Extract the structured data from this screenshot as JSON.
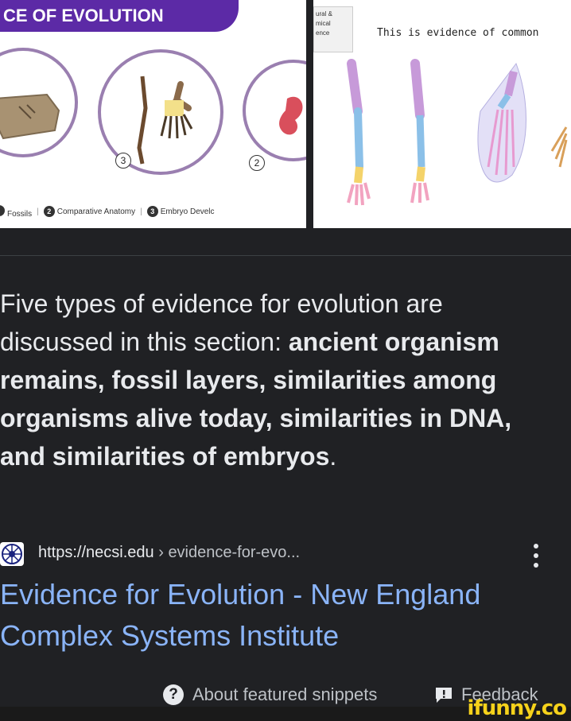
{
  "images": {
    "left": {
      "banner": "CE OF EVOLUTION",
      "circle_numbers": [
        "3",
        "2"
      ],
      "legend": [
        {
          "num": "",
          "label": "Fossils"
        },
        {
          "num": "2",
          "label": "Comparative Anatomy"
        },
        {
          "num": "3",
          "label": "Embryo Develc"
        }
      ]
    },
    "right": {
      "side_label_lines": [
        "ural &",
        "mical",
        "ence"
      ],
      "caption": "This is evidence of common"
    }
  },
  "snippet": {
    "text_plain": "Five types of evidence for evolution are discussed in this section: ",
    "text_bold": "ancient organism remains, fossil layers, similarities among organisms alive today, similarities in DNA, and similarities of embryos",
    "text_end": "."
  },
  "source": {
    "icon": "necsi-globe-icon",
    "domain": "https://necsi.edu",
    "separator": " › ",
    "path": "evidence-for-evo...",
    "menu_icon": "more-vert-icon"
  },
  "result": {
    "title": "Evidence for Evolution - New England Complex Systems Institute"
  },
  "footer": {
    "help_icon": "question-circle-icon",
    "about_label": "About featured snippets",
    "feedback_icon": "feedback-icon",
    "feedback_label": "Feedback"
  },
  "watermark": "ifunny.co",
  "colors": {
    "background": "#202124",
    "link": "#8ab4f8",
    "text": "#e8eaed",
    "banner": "#5c2aa6",
    "watermark": "#f6d21b"
  }
}
